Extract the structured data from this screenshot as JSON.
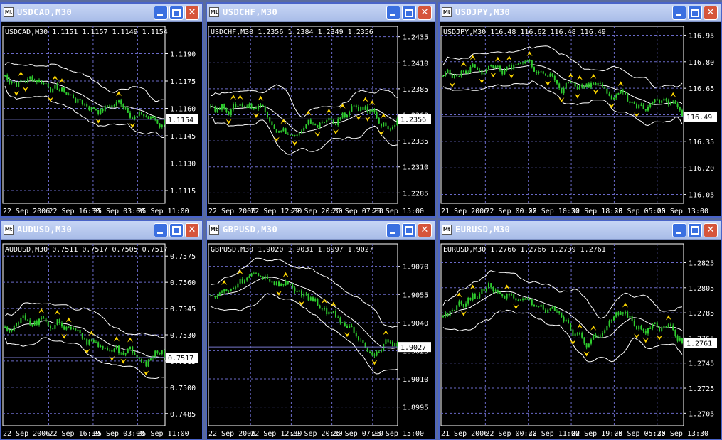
{
  "colors": {
    "desktop": "#5a6b9c",
    "title_gradient_top": "#c7d6f5",
    "title_gradient_bottom": "#a9bde8",
    "chart_bg": "#000000",
    "candle": "#2ecc2e",
    "band": "#ffffff",
    "grid": "#6a6ac8",
    "arrow": "#ffd700",
    "price_line": "#7777cc"
  },
  "icons": {
    "app": "mt4-app-icon",
    "minimize": "minimize-icon",
    "maximize": "maximize-icon",
    "close": "close-icon"
  },
  "windows": [
    {
      "title": "USDCAD,M30",
      "header": "USDCAD,M30  1.1151 1.1157 1.1149 1.1154",
      "current": "1.1154",
      "ylabels": [
        "1.1190",
        "1.1175",
        "1.1160",
        "1.1145",
        "1.1130",
        "1.1115"
      ],
      "ymin": 1.1108,
      "ymax": 1.1205,
      "xlabels": [
        "22 Sep 2006",
        "22 Sep 16:30",
        "25 Sep 03:00",
        "25 Sep 11:00"
      ]
    },
    {
      "title": "USDCHF,M30",
      "header": "USDCHF,M30  1.2356 1.2384 1.2349 1.2356",
      "current": "1.2356",
      "ylabels": [
        "1.2435",
        "1.2410",
        "1.2385",
        "1.2360",
        "1.2335",
        "1.2310",
        "1.2285"
      ],
      "ymin": 1.2275,
      "ymax": 1.2445,
      "xlabels": [
        "22 Sep 2006",
        "22 Sep 12:30",
        "22 Sep 20:30",
        "25 Sep 07:00",
        "25 Sep 15:00"
      ]
    },
    {
      "title": "USDJPY,M30",
      "header": "USDJPY,M30  116.48 116.62 116.48 116.49",
      "current": "116.49",
      "ylabels": [
        "116.95",
        "116.80",
        "116.65",
        "116.50",
        "116.35",
        "116.20",
        "116.05"
      ],
      "ymin": 116.0,
      "ymax": 117.0,
      "xlabels": [
        "21 Sep 2006",
        "22 Sep 00:00",
        "22 Sep 10:30",
        "22 Sep 18:30",
        "25 Sep 05:00",
        "25 Sep 13:00"
      ]
    },
    {
      "title": "AUDUSD,M30",
      "header": "AUDUSD,M30  0.7511 0.7517 0.7505 0.7517",
      "current": "0.7517",
      "ylabels": [
        "0.7575",
        "0.7560",
        "0.7545",
        "0.7530",
        "0.7515",
        "0.7500",
        "0.7485"
      ],
      "ymin": 0.7478,
      "ymax": 0.7582,
      "xlabels": [
        "22 Sep 2006",
        "22 Sep 16:30",
        "25 Sep 03:00",
        "25 Sep 11:00"
      ]
    },
    {
      "title": "GBPUSD,M30",
      "header": "GBPUSD,M30  1.9020 1.9031 1.8997 1.9027",
      "current": "1.9027",
      "ylabels": [
        "1.9070",
        "1.9055",
        "1.9040",
        "1.9025",
        "1.9010",
        "1.8995"
      ],
      "ymin": 1.8985,
      "ymax": 1.9082,
      "xlabels": [
        "22 Sep 2006",
        "22 Sep 12:30",
        "22 Sep 20:30",
        "25 Sep 07:00",
        "25 Sep 15:00"
      ]
    },
    {
      "title": "EURUSD,M30",
      "header": "EURUSD,M30  1.2766 1.2766 1.2739 1.2761",
      "current": "1.2761",
      "ylabels": [
        "1.2825",
        "1.2805",
        "1.2785",
        "1.2765",
        "1.2745",
        "1.2725",
        "1.2705"
      ],
      "ymin": 1.2695,
      "ymax": 1.284,
      "xlabels": [
        "21 Sep 2006",
        "22 Sep 00:30",
        "22 Sep 11:00",
        "22 Sep 19:00",
        "25 Sep 05:30",
        "25 Sep 13:30"
      ]
    }
  ]
}
